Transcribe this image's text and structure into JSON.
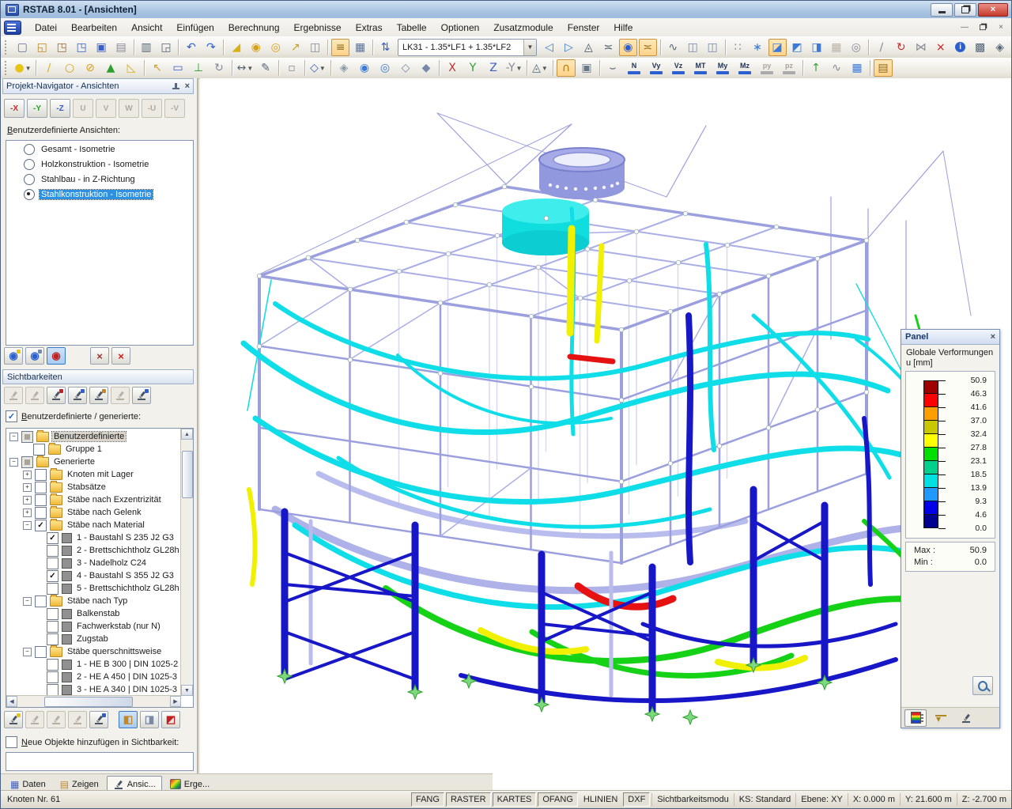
{
  "window": {
    "title": "RSTAB 8.01 - [Ansichten]",
    "close_glyph": "×"
  },
  "menu": {
    "items": [
      "Datei",
      "Bearbeiten",
      "Ansicht",
      "Einfügen",
      "Berechnung",
      "Ergebnisse",
      "Extras",
      "Tabelle",
      "Optionen",
      "Zusatzmodule",
      "Fenster",
      "Hilfe"
    ]
  },
  "toolbar1": {
    "combo_value": "LK31 - 1.35*LF1 + 1.35*LF2",
    "buttons": [
      {
        "n": "new-file",
        "g": "▢",
        "c": "#607090"
      },
      {
        "n": "open-file",
        "g": "◱",
        "c": "#C8871E"
      },
      {
        "n": "project-manager",
        "g": "◳",
        "c": "#9A6A32"
      },
      {
        "n": "block-manager",
        "g": "◳",
        "c": "#3A5FC8"
      },
      {
        "n": "save",
        "g": "▣",
        "c": "#3A5FC8"
      },
      {
        "n": "paste",
        "g": "▤",
        "c": "#888899"
      },
      {
        "sep": true
      },
      {
        "n": "print",
        "g": "▥",
        "c": "#556677"
      },
      {
        "n": "print-preview",
        "g": "◲",
        "c": "#556677"
      },
      {
        "sep": true
      },
      {
        "n": "undo",
        "g": "↶",
        "c": "#2B5FD0"
      },
      {
        "n": "redo",
        "g": "↷",
        "c": "#2B5FD0"
      },
      {
        "sep": true
      },
      {
        "n": "new-model-data",
        "g": "◢",
        "c": "#D8B018"
      },
      {
        "n": "generate-loads",
        "g": "◉",
        "c": "#D8A018"
      },
      {
        "n": "regenerate-loads",
        "g": "◎",
        "c": "#D8A018"
      },
      {
        "n": "pick-object",
        "g": "↗",
        "c": "#C8A018"
      },
      {
        "n": "copy-window",
        "g": "◫",
        "c": "#888899"
      },
      {
        "sep": true
      },
      {
        "n": "display-tables",
        "g": "≡",
        "c": "#8A6A20",
        "hl": true
      },
      {
        "n": "table-grid",
        "g": "▦",
        "c": "#607090"
      },
      {
        "sep": true
      },
      {
        "n": "goto-loadcase",
        "g": "⇅",
        "c": "#2B5FD0"
      },
      {
        "combo": true
      },
      {
        "n": "previous-loadcase",
        "g": "◁",
        "c": "#3A7AD8"
      },
      {
        "n": "next-loadcase",
        "g": "▷",
        "c": "#3A7AD8"
      },
      {
        "n": "results-mode",
        "g": "◬",
        "c": "#445566"
      },
      {
        "n": "result-values-mode",
        "g": "≍",
        "c": "#445566"
      },
      {
        "n": "show-results",
        "g": "◉",
        "c": "#2B5FD0",
        "hl": true
      },
      {
        "n": "show-result-values",
        "g": "≍",
        "c": "#8A6A20",
        "hl": true
      },
      {
        "sep": true
      },
      {
        "n": "load-display",
        "g": "∿",
        "c": "#556677"
      },
      {
        "n": "window-arrange-1",
        "g": "◫",
        "c": "#7788AA"
      },
      {
        "n": "window-arrange-2",
        "g": "◫",
        "c": "#7788AA"
      },
      {
        "sep": true
      },
      {
        "n": "move-grid",
        "g": "∷",
        "c": "#888899"
      },
      {
        "n": "snap-grid",
        "g": "∗",
        "c": "#3A7AD8"
      },
      {
        "n": "workplane-xy",
        "g": "◪",
        "c": "#3A7AD8",
        "hl": true
      },
      {
        "n": "workplane-yz",
        "g": "◩",
        "c": "#3A7AD8"
      },
      {
        "n": "workplane-xz",
        "g": "◨",
        "c": "#3A7AD8"
      },
      {
        "n": "grid-settings",
        "g": "▦",
        "c": "#AAAABB",
        "dis": true
      },
      {
        "n": "selection-mode",
        "g": "◎",
        "c": "#888899"
      },
      {
        "sep": true
      },
      {
        "n": "select-line",
        "g": "∕",
        "c": "#888899"
      },
      {
        "n": "rotate-view",
        "g": "↻",
        "c": "#C03030"
      },
      {
        "n": "mirror",
        "g": "⋈",
        "c": "#888899"
      },
      {
        "n": "delete",
        "g": "×",
        "c": "#C02020"
      },
      {
        "n": "info",
        "g": "i",
        "circ": "#2B5FD0"
      },
      {
        "n": "module-notes",
        "g": "▩",
        "c": "#556677"
      },
      {
        "n": "options",
        "g": "◈",
        "c": "#556677"
      }
    ]
  },
  "toolbar2": {
    "buttons": [
      {
        "n": "new-node",
        "g": "●",
        "c": "#E8C418",
        "dd": true
      },
      {
        "sep": true
      },
      {
        "n": "new-member",
        "g": "∕",
        "c": "#D8B018"
      },
      {
        "n": "node-on-member",
        "g": "○",
        "c": "#D8A018"
      },
      {
        "n": "divide-member",
        "g": "⊘",
        "c": "#D8A018"
      },
      {
        "n": "connect-members",
        "g": "▲",
        "c": "#2FA02F"
      },
      {
        "n": "extend-member",
        "g": "◺",
        "c": "#D8B018"
      },
      {
        "sep": true
      },
      {
        "n": "move-node",
        "g": "↖",
        "c": "#D8A020"
      },
      {
        "n": "frame-join",
        "g": "▭",
        "c": "#3A5FC8"
      },
      {
        "n": "new-support",
        "g": "⊥",
        "c": "#2FA02F"
      },
      {
        "n": "rotate-member",
        "g": "↻",
        "c": "#888899"
      },
      {
        "sep": true
      },
      {
        "n": "dimension",
        "g": "↔",
        "c": "#556677",
        "dd": true
      },
      {
        "n": "comment",
        "g": "✎",
        "c": "#556677"
      },
      {
        "sep": true
      },
      {
        "n": "select-window",
        "g": "▫",
        "c": "#888899"
      },
      {
        "sep": true
      },
      {
        "n": "visual-object",
        "g": "◇",
        "c": "#3A5FC8",
        "dd": true
      },
      {
        "sep": true
      },
      {
        "n": "render-mode",
        "g": "◈",
        "c": "#8899AA"
      },
      {
        "n": "zoom-window",
        "g": "◉",
        "c": "#3A7AD8"
      },
      {
        "n": "zoom-out",
        "g": "◎",
        "c": "#3A7AD8"
      },
      {
        "n": "wireframe-view",
        "g": "◇",
        "c": "#7788AA"
      },
      {
        "n": "solid-view",
        "g": "◆",
        "c": "#7788AA"
      },
      {
        "sep": true
      },
      {
        "n": "view-x",
        "g": "X",
        "c": "#C03030"
      },
      {
        "n": "view-y",
        "g": "Y",
        "c": "#2FA02F"
      },
      {
        "n": "view-z",
        "g": "Z",
        "c": "#3A5FC8"
      },
      {
        "n": "view-minus-y",
        "g": "-Y",
        "c": "#888899",
        "dd": true
      },
      {
        "sep": true
      },
      {
        "n": "isometric-view",
        "g": "◬",
        "c": "#556677",
        "dd": true
      },
      {
        "sep": true
      },
      {
        "n": "result-diagrams",
        "g": "∩",
        "c": "#B87800",
        "hl": true
      },
      {
        "n": "print-graphic",
        "g": "▣",
        "c": "#667788"
      },
      {
        "sep": true
      },
      {
        "n": "show-deformation",
        "g": "⌣",
        "c": "#445566"
      },
      {
        "lbl": "N",
        "bar": "#2B5FD0",
        "n": "result-n"
      },
      {
        "lbl": "Vy",
        "bar": "#2B5FD0",
        "n": "result-vy"
      },
      {
        "lbl": "Vz",
        "bar": "#2B5FD0",
        "n": "result-vz"
      },
      {
        "lbl": "MT",
        "bar": "#2B5FD0",
        "n": "result-mt"
      },
      {
        "lbl": "My",
        "bar": "#2B5FD0",
        "n": "result-my"
      },
      {
        "lbl": "Mz",
        "bar": "#2B5FD0",
        "n": "result-mz"
      },
      {
        "lbl": "py",
        "bar": "#AAAAAA",
        "dis": true,
        "n": "result-py"
      },
      {
        "lbl": "pz",
        "bar": "#AAAAAA",
        "dis": true,
        "n": "result-pz"
      },
      {
        "sep": true
      },
      {
        "n": "animate-deformation",
        "g": "↑",
        "c": "#2FA02F"
      },
      {
        "n": "smooth-diagrams",
        "g": "∿",
        "c": "#888899"
      },
      {
        "n": "result-tables",
        "g": "▦",
        "c": "#3A7AD8"
      },
      {
        "sep": true
      },
      {
        "n": "control-panel",
        "g": "▤",
        "c": "#8A6A20",
        "hl": true
      }
    ]
  },
  "navigator": {
    "title": "Projekt-Navigator - Ansichten",
    "view_buttons": [
      {
        "label": "-X",
        "c": "#C03030",
        "enabled": true
      },
      {
        "label": "-Y",
        "c": "#2FA02F",
        "enabled": true
      },
      {
        "label": "-Z",
        "c": "#3A5FC8",
        "enabled": true
      },
      {
        "label": "U",
        "enabled": false
      },
      {
        "label": "V",
        "enabled": false
      },
      {
        "label": "W",
        "enabled": false
      },
      {
        "label": "-U",
        "enabled": false
      },
      {
        "label": "-V",
        "enabled": false
      }
    ],
    "views_label": "Benutzerdefinierte Ansichten:",
    "views": [
      {
        "label": "Gesamt - Isometrie",
        "selected": false
      },
      {
        "label": "Holzkonstruktion - Isometrie",
        "selected": false
      },
      {
        "label": "Stahlbau - in Z-Richtung",
        "selected": false
      },
      {
        "label": "Stahlkonstruktion - Isometrie",
        "selected": true
      }
    ],
    "eye_buttons": [
      {
        "n": "visibility-new",
        "g": "◉",
        "c": "#2B5FD0",
        "accent": "#E8C418"
      },
      {
        "n": "visibility-by-views",
        "g": "◉",
        "c": "#2B5FD0",
        "accent": "#7788AA"
      },
      {
        "n": "visibility-cancel",
        "g": "◉",
        "c": "#C02020",
        "active": true
      },
      {
        "gap": 28
      },
      {
        "n": "view-delete",
        "g": "×",
        "c": "#A03030"
      },
      {
        "n": "view-delete-all",
        "g": "×",
        "c": "#D01818"
      }
    ],
    "visibility_header": "Sichtbarkeiten",
    "vis_buttons": [
      {
        "n": "vis-mode-all",
        "dis": true
      },
      {
        "n": "vis-mode-covered",
        "dis": true
      },
      {
        "n": "vis-by-selection",
        "accent": "#C02020"
      },
      {
        "n": "vis-by-number",
        "accent": "#3A5FC8"
      },
      {
        "n": "vis-partial",
        "accent": "#C8861E"
      },
      {
        "n": "vis-inverse",
        "dis": true
      },
      {
        "n": "vis-cancel",
        "accent": "#2B5FD0"
      }
    ],
    "generated_checkbox": {
      "checked": true,
      "label": "Benutzerdefinierte / generierte:"
    },
    "tree": [
      {
        "level": 1,
        "exp": "-",
        "check": "part",
        "icon": "folder",
        "label": "Benutzerdefinierte",
        "focus": true
      },
      {
        "level": 2,
        "check": "off",
        "icon": "folder",
        "label": "Gruppe 1"
      },
      {
        "level": 1,
        "exp": "-",
        "check": "part",
        "icon": "folder",
        "label": "Generierte"
      },
      {
        "level": 2,
        "exp": "+",
        "check": "off",
        "icon": "folder",
        "label": "Knoten mit Lager"
      },
      {
        "level": 2,
        "exp": "+",
        "check": "off",
        "icon": "folder",
        "label": "Stabsätze"
      },
      {
        "level": 2,
        "exp": "+",
        "check": "off",
        "icon": "folder",
        "label": "Stäbe nach Exzentrizität"
      },
      {
        "level": 2,
        "exp": "+",
        "check": "off",
        "icon": "folder",
        "label": "Stäbe nach Gelenk"
      },
      {
        "level": 2,
        "exp": "-",
        "check": "on",
        "icon": "folder",
        "label": "Stäbe nach Material"
      },
      {
        "level": 3,
        "check": "on",
        "icon": "swatch",
        "label": "1 - Baustahl S 235 J2 G3"
      },
      {
        "level": 3,
        "check": "off",
        "icon": "swatch",
        "label": "2 - Brettschichtholz GL28h"
      },
      {
        "level": 3,
        "check": "off",
        "icon": "swatch",
        "label": "3 - Nadelholz C24"
      },
      {
        "level": 3,
        "check": "on",
        "icon": "swatch",
        "label": "4 - Baustahl S 355 J2 G3"
      },
      {
        "level": 3,
        "check": "off",
        "icon": "swatch",
        "label": "5 - Brettschichtholz GL28h"
      },
      {
        "level": 2,
        "exp": "-",
        "check": "off",
        "icon": "folder",
        "label": "Stäbe nach Typ"
      },
      {
        "level": 3,
        "check": "off",
        "icon": "swatch",
        "label": "Balkenstab"
      },
      {
        "level": 3,
        "check": "off",
        "icon": "swatch",
        "label": "Fachwerkstab (nur N)"
      },
      {
        "level": 3,
        "check": "off",
        "icon": "swatch",
        "label": "Zugstab"
      },
      {
        "level": 2,
        "exp": "-",
        "check": "off",
        "icon": "folder",
        "label": "Stäbe querschnittsweise"
      },
      {
        "level": 3,
        "check": "off",
        "icon": "swatch",
        "label": "1 - HE B 300 | DIN 1025-2"
      },
      {
        "level": 3,
        "check": "off",
        "icon": "swatch",
        "label": "2 - HE A 450 | DIN 1025-3"
      },
      {
        "level": 3,
        "check": "off",
        "icon": "swatch",
        "label": "3 - HE A 340 | DIN 1025-3"
      }
    ],
    "bottom_buttons": [
      {
        "n": "vis-edit",
        "accent": "#E8C418"
      },
      {
        "n": "vis-tool-2",
        "dis": true
      },
      {
        "n": "vis-tool-3",
        "dis": true
      },
      {
        "n": "vis-tool-4",
        "dis": true
      },
      {
        "n": "vis-apply",
        "accent": "#2B5FD0"
      },
      {
        "gap": 10
      },
      {
        "n": "vis-union",
        "g": "◧",
        "c": "#C8861E",
        "active": true
      },
      {
        "n": "vis-intersection",
        "g": "◨",
        "c": "#7788AA"
      },
      {
        "n": "vis-difference",
        "g": "◩",
        "c": "#C02020"
      }
    ],
    "new_objects_checkbox": {
      "checked": false,
      "label": "Neue Objekte hinzufügen in Sichtbarkeit:"
    },
    "tabs": [
      {
        "label": "Daten",
        "icon": "daten",
        "active": false
      },
      {
        "label": "Zeigen",
        "icon": "zeigen",
        "active": false
      },
      {
        "label": "Ansic...",
        "icon": "scope",
        "active": true
      },
      {
        "label": "Erge...",
        "icon": "grad",
        "active": false
      }
    ]
  },
  "panel": {
    "title": "Panel",
    "close_glyph": "×",
    "legend_title_line1": "Globale Verformungen",
    "legend_title_line2": "u [mm]",
    "values": [
      "50.9",
      "46.3",
      "41.6",
      "37.0",
      "32.4",
      "27.8",
      "23.1",
      "18.5",
      "13.9",
      "9.3",
      "4.6",
      "0.0"
    ],
    "colors": [
      "#A00000",
      "#FF0000",
      "#FF9E00",
      "#C8C800",
      "#FFFF00",
      "#00E000",
      "#00D08C",
      "#00E0E0",
      "#1E9AFF",
      "#0000E8",
      "#000090"
    ],
    "max_row": {
      "label": "Max :",
      "value": "50.9"
    },
    "min_row": {
      "label": "Min :",
      "value": "0.0"
    }
  },
  "statusbar": {
    "left": "Knoten Nr. 61",
    "toggles": [
      {
        "label": "FANG",
        "pressed": true
      },
      {
        "label": "RASTER",
        "pressed": true
      },
      {
        "label": "KARTES",
        "pressed": true
      },
      {
        "label": "OFANG",
        "pressed": true
      },
      {
        "label": "HLINIEN",
        "pressed": false
      },
      {
        "label": "DXF",
        "pressed": true
      }
    ],
    "cells": [
      "Sichtbarkeitsmodu",
      "KS: Standard",
      "Ebene: XY",
      "X:  0.000 m",
      "Y:  21.600 m",
      "Z:  -2.700 m"
    ]
  }
}
